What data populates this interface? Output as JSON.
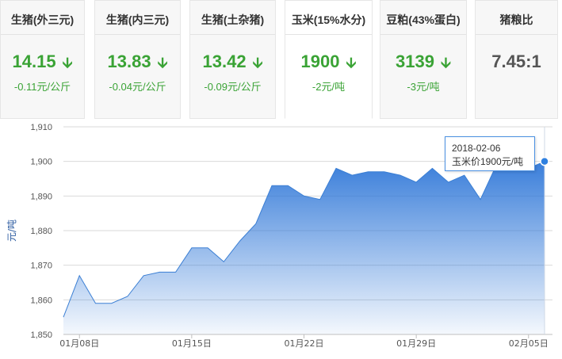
{
  "cards": [
    {
      "title": "生猪(外三元)",
      "price": "14.15",
      "change": "-0.11元/公斤"
    },
    {
      "title": "生猪(内三元)",
      "price": "13.83",
      "change": "-0.04元/公斤"
    },
    {
      "title": "生猪(土杂猪)",
      "price": "13.42",
      "change": "-0.09元/公斤"
    },
    {
      "title": "玉米(15%水分)",
      "price": "1900",
      "change": "-2元/吨"
    },
    {
      "title": "豆粕(43%蛋白)",
      "price": "3139",
      "change": "-3元/吨"
    },
    {
      "title": "猪粮比",
      "value": "7.45:1"
    }
  ],
  "arrow_icon": "down-arrow-icon",
  "colors": {
    "down": "#3aa335",
    "line": "#3b7fd4",
    "accent": "#2f80e0"
  },
  "tooltip": {
    "date": "2018-02-06",
    "text": "玉米价1900元/吨"
  },
  "chart_data": {
    "type": "area",
    "ylabel": "元/吨",
    "ylim": [
      1850,
      1910
    ],
    "yticks": [
      "1,850",
      "1,860",
      "1,870",
      "1,880",
      "1,890",
      "1,900",
      "1,910"
    ],
    "x": [
      "2018-01-07",
      "2018-01-08",
      "2018-01-09",
      "2018-01-10",
      "2018-01-11",
      "2018-01-12",
      "2018-01-13",
      "2018-01-14",
      "2018-01-15",
      "2018-01-16",
      "2018-01-17",
      "2018-01-18",
      "2018-01-19",
      "2018-01-20",
      "2018-01-21",
      "2018-01-22",
      "2018-01-23",
      "2018-01-24",
      "2018-01-25",
      "2018-01-26",
      "2018-01-27",
      "2018-01-28",
      "2018-01-29",
      "2018-01-30",
      "2018-01-31",
      "2018-02-01",
      "2018-02-02",
      "2018-02-03",
      "2018-02-04",
      "2018-02-05",
      "2018-02-06"
    ],
    "values": [
      1855,
      1867,
      1859,
      1859,
      1861,
      1867,
      1868,
      1868,
      1875,
      1875,
      1871,
      1877,
      1882,
      1893,
      1893,
      1890,
      1889,
      1898,
      1896,
      1897,
      1897,
      1896,
      1894,
      1898,
      1894,
      1896,
      1889,
      1899,
      1900,
      1898,
      1900
    ],
    "xticks": [
      {
        "date": "2018-01-08",
        "label": "01月08日"
      },
      {
        "date": "2018-01-15",
        "label": "01月15日"
      },
      {
        "date": "2018-01-22",
        "label": "01月22日"
      },
      {
        "date": "2018-01-29",
        "label": "01月29日"
      },
      {
        "date": "2018-02-05",
        "label": "02月05日"
      }
    ],
    "highlight": {
      "date": "2018-02-06",
      "value": 1900
    }
  }
}
